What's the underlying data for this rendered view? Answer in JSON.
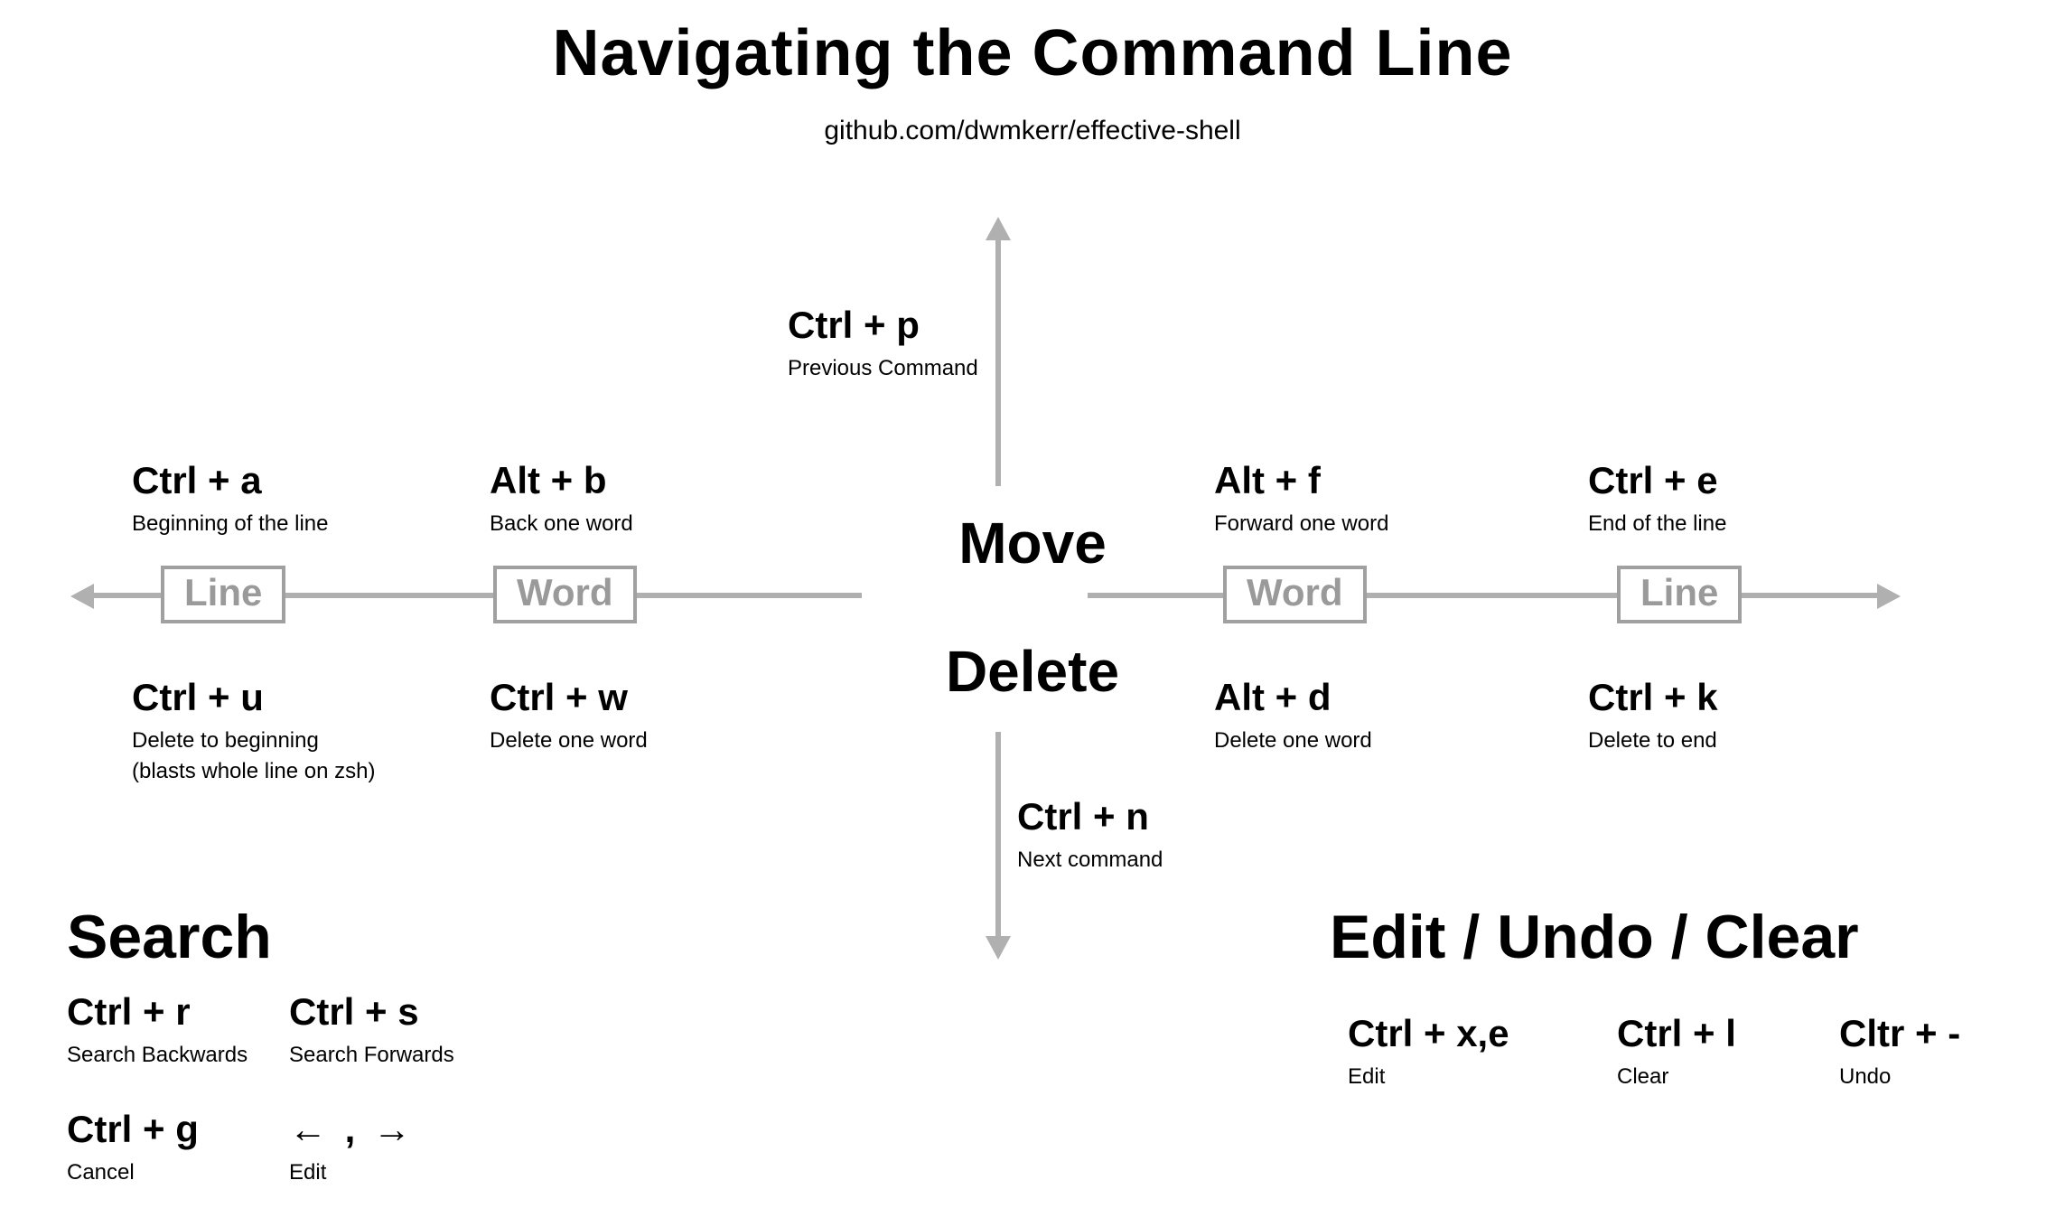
{
  "title": "Navigating the Command Line",
  "subtitle": "github.com/dwmkerr/effective-shell",
  "center": {
    "move": "Move",
    "delete": "Delete"
  },
  "scopes": {
    "line": "Line",
    "word": "Word"
  },
  "up": {
    "key": "Ctrl + p",
    "desc": "Previous Command"
  },
  "down": {
    "key": "Ctrl + n",
    "desc": "Next command"
  },
  "move_left_line": {
    "key": "Ctrl + a",
    "desc": "Beginning of the line"
  },
  "move_left_word": {
    "key": "Alt + b",
    "desc": "Back one word"
  },
  "move_right_word": {
    "key": "Alt + f",
    "desc": "Forward one word"
  },
  "move_right_line": {
    "key": "Ctrl + e",
    "desc": "End of the line"
  },
  "del_left_line": {
    "key": "Ctrl + u",
    "desc": "Delete to beginning",
    "desc2": "(blasts whole line on zsh)"
  },
  "del_left_word": {
    "key": "Ctrl + w",
    "desc": "Delete one word"
  },
  "del_right_word": {
    "key": "Alt + d",
    "desc": "Delete one word"
  },
  "del_right_line": {
    "key": "Ctrl + k",
    "desc": "Delete to end"
  },
  "search": {
    "heading": "Search",
    "back": {
      "key": "Ctrl + r",
      "desc": "Search Backwards"
    },
    "fwd": {
      "key": "Ctrl + s",
      "desc": "Search Forwards"
    },
    "cancel": {
      "key": "Ctrl + g",
      "desc": "Cancel"
    },
    "edit": {
      "key_glyph": "← , →",
      "desc": "Edit"
    }
  },
  "euc": {
    "heading": "Edit / Undo / Clear",
    "edit": {
      "key": "Ctrl + x,e",
      "desc": "Edit"
    },
    "clear": {
      "key": "Ctrl + l",
      "desc": "Clear"
    },
    "undo": {
      "key": "Cltr + -",
      "desc": "Undo"
    }
  }
}
